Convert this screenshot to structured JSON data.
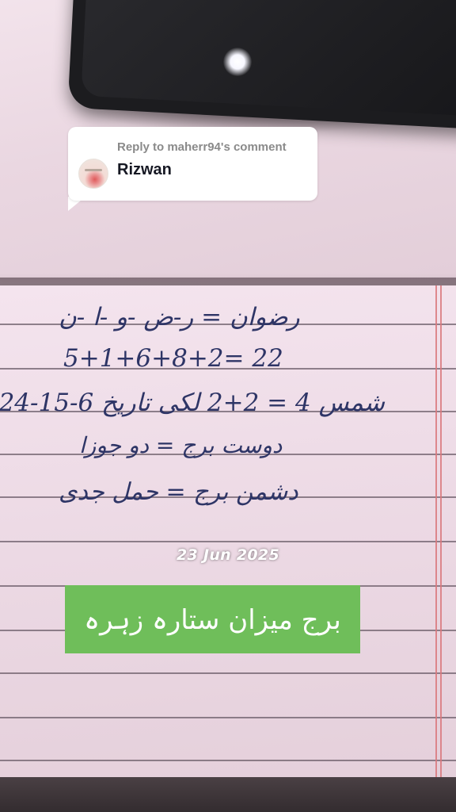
{
  "reply": {
    "header": "Reply to maherr94's comment",
    "username": "Rizwan"
  },
  "note": {
    "lines": [
      "رضوان = ر-ض -و -ا -ن",
      "5+1+6+8+2= 22",
      "شمس 4 = 2+2 لکی تاریخ 6-15-24",
      "دوست برج = دو جوزا",
      "دشمن برج = حمل جدی"
    ]
  },
  "date_stamp": "23 Jun 2025",
  "caption": "برج میزان ستارہ زہرہ",
  "colors": {
    "caption_bg": "#6fbe5a",
    "ink": "#2e3566",
    "paper": "#ecd9e4"
  }
}
